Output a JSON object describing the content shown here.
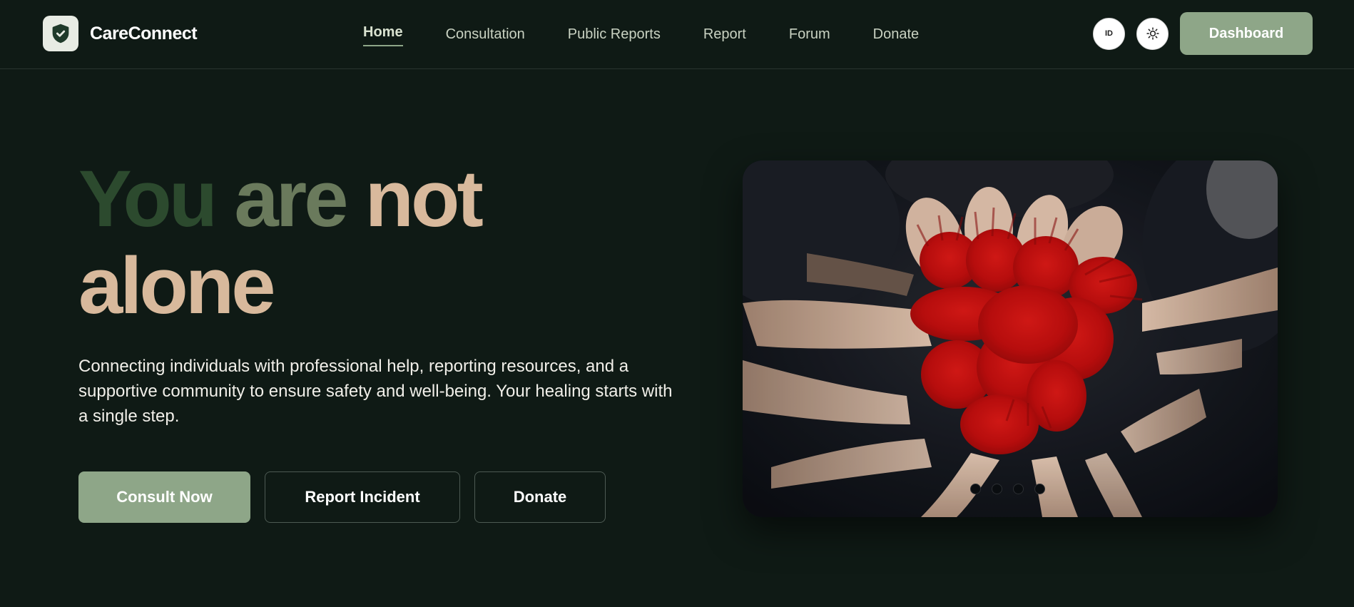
{
  "brand": {
    "name": "CareConnect",
    "logo_icon": "shield-check-icon"
  },
  "nav": {
    "items": [
      {
        "label": "Home",
        "active": true
      },
      {
        "label": "Consultation",
        "active": false
      },
      {
        "label": "Public Reports",
        "active": false
      },
      {
        "label": "Report",
        "active": false
      },
      {
        "label": "Forum",
        "active": false
      },
      {
        "label": "Donate",
        "active": false
      }
    ],
    "language_label": "ID",
    "theme_icon": "sun-icon",
    "dashboard_label": "Dashboard"
  },
  "hero": {
    "title_words": [
      "You",
      "are",
      "not",
      "alone"
    ],
    "description": "Connecting individuals with professional help, reporting resources, and a supportive community to ensure safety and well-being. Your healing starts with a single step.",
    "buttons": {
      "consult": "Consult Now",
      "report": "Report Incident",
      "donate": "Donate"
    }
  },
  "carousel": {
    "image_subject": "hands-painted-red-forming-heart-image",
    "slides_count": 4,
    "active_slide": 1
  },
  "colors": {
    "background": "#0f1a15",
    "accent": "#8ea688",
    "title_dark_green": "#2c4a2e",
    "title_olive": "#6a7a5c",
    "title_tan": "#d8b99c"
  }
}
